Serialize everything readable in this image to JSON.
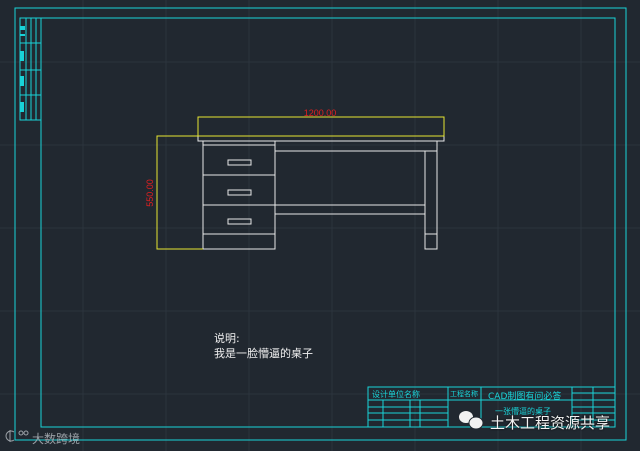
{
  "drawing": {
    "dimension_width": "1200.00",
    "dimension_height": "550.00",
    "note_title": "说明:",
    "note_text": "我是一脸懵逼的桌子"
  },
  "title_block": {
    "design_unit_label": "设计单位名称",
    "project_name_label": "工程名称",
    "project_name": "CAD制图有问必答",
    "drawing_name": "一张懵逼的桌子"
  },
  "watermarks": {
    "wechat": "土木工程资源共享",
    "brand": "大数跨境"
  },
  "colors": {
    "background": "#212830",
    "frame": "#19d3d8",
    "dimension": "#e02020",
    "highlight": "#e6e632",
    "geometry": "#e8e8e8"
  }
}
